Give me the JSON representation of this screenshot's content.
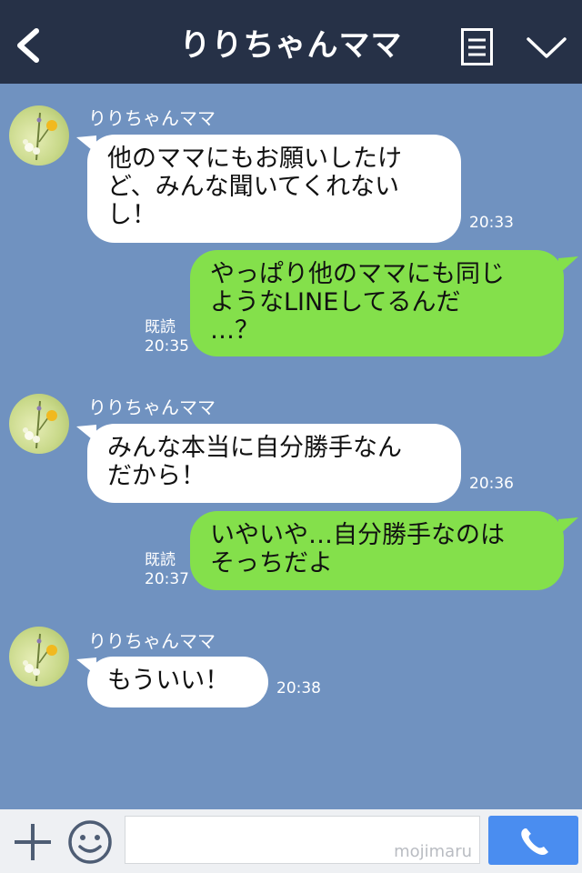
{
  "header": {
    "title": "りりちゃんママ",
    "back_icon": "chevron-left-icon",
    "menu_icon": "list-icon",
    "dropdown_icon": "chevron-down-icon",
    "background": "#263147"
  },
  "chat": {
    "background": "#7092c0",
    "messages": [
      {
        "side": "in",
        "sender": "りりちゃんママ",
        "text": "他のママにもお願いしたけ\nど、みんな聞いてくれない\nし！",
        "time": "20:33"
      },
      {
        "side": "out",
        "text": "やっぱり他のママにも同じ\nようなLINEしてるんだ\n…？",
        "read": "既読",
        "time": "20:35"
      },
      {
        "side": "in",
        "sender": "りりちゃんママ",
        "text": "みんな本当に自分勝手なん\nだから！",
        "time": "20:36"
      },
      {
        "side": "out",
        "text": "いやいや…自分勝手なのは\nそっちだよ",
        "read": "既読",
        "time": "20:37"
      },
      {
        "side": "in",
        "sender": "りりちゃんママ",
        "text": "もういい！",
        "time": "20:38"
      }
    ]
  },
  "input_bar": {
    "plus_icon": "plus-icon",
    "emoji_icon": "smiley-icon",
    "watermark": "mojimaru",
    "call_icon": "phone-icon",
    "call_color": "#4a8df0"
  },
  "colors": {
    "incoming_bubble": "#ffffff",
    "outgoing_bubble": "#84e04b"
  }
}
